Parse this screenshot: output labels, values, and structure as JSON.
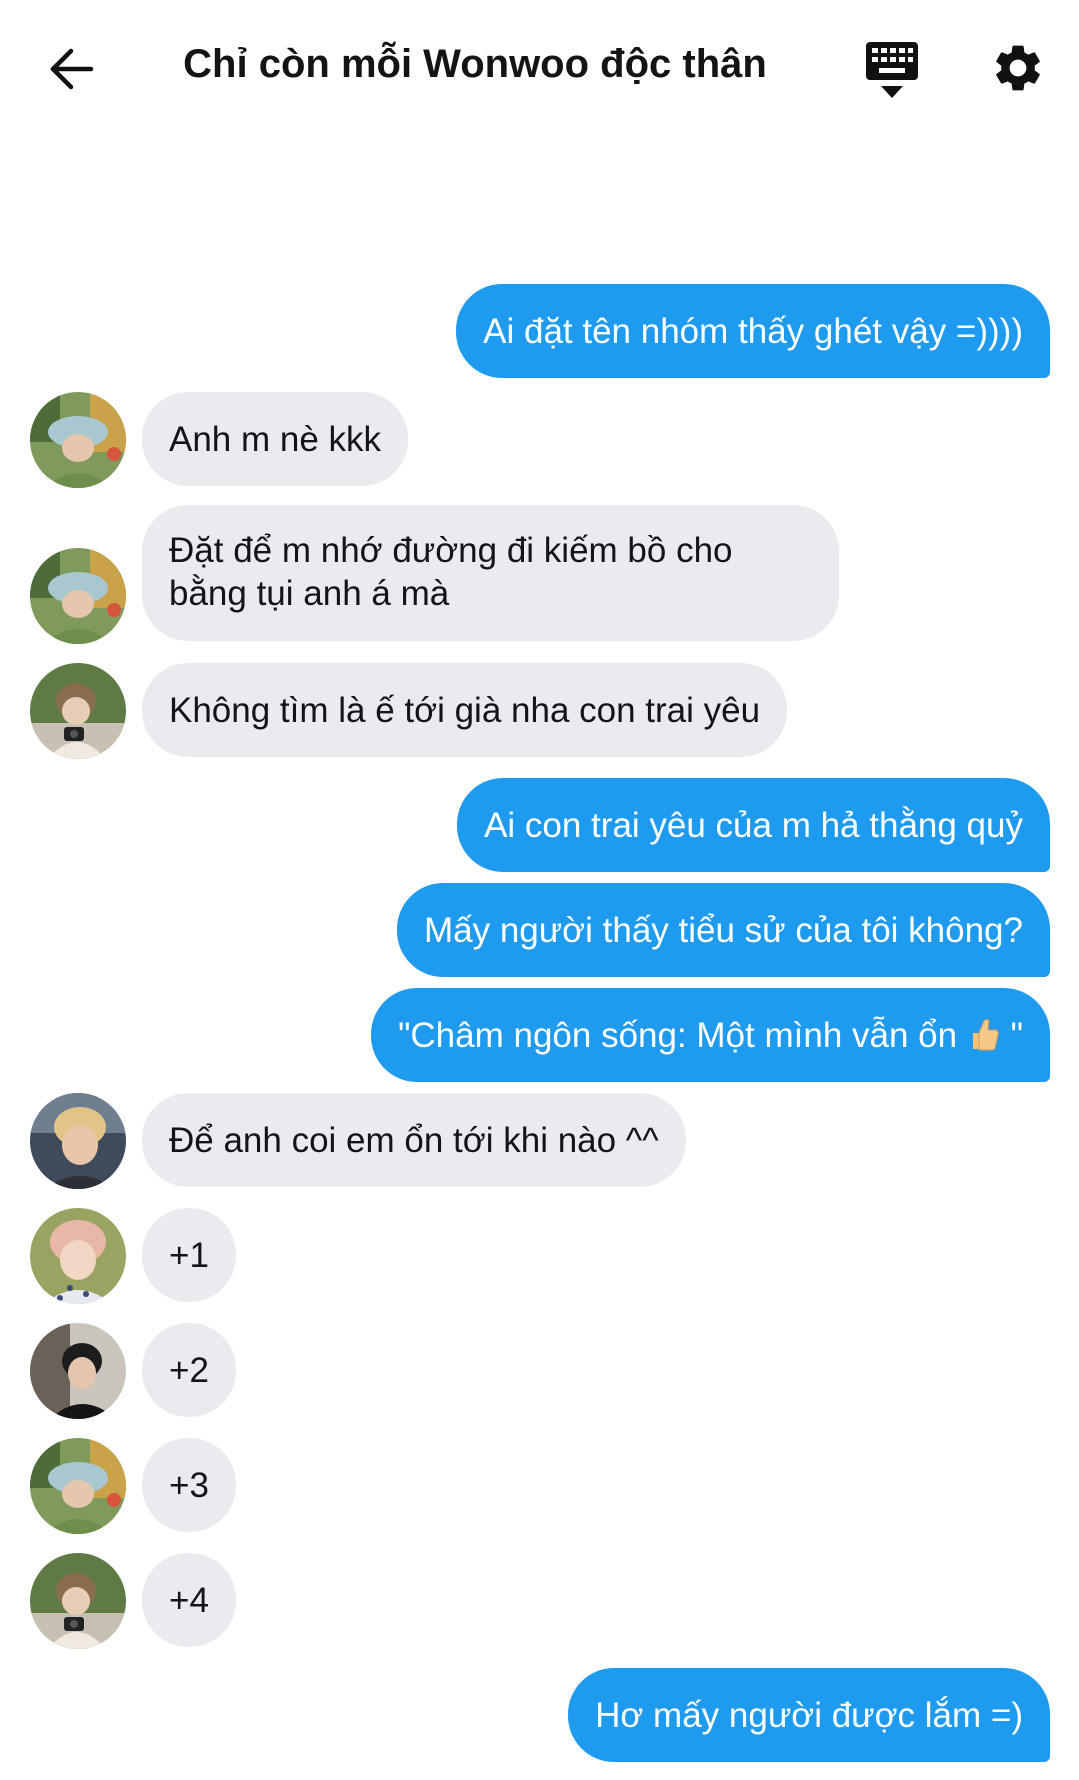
{
  "header": {
    "title": "Chỉ còn mỗi Wonwoo độc thân",
    "back_icon": "arrow-left-icon",
    "keyboard_icon": "keyboard-hide-icon",
    "settings_icon": "gear-icon"
  },
  "colors": {
    "outgoing_bubble": "#1e9bef",
    "incoming_bubble": "#e9ebef",
    "outgoing_text": "#ffffff",
    "incoming_text": "#121417"
  },
  "messages": [
    {
      "side": "out",
      "text": "Ai đặt tên nhóm thấy ghét vậy =))))"
    },
    {
      "side": "in",
      "avatar": "avatar-bucket-hat",
      "text": "Anh m nè kkk"
    },
    {
      "side": "in",
      "avatar": "avatar-bucket-hat",
      "text": "Đặt để m nhớ đường đi kiếm bồ cho bằng tụi anh á mà"
    },
    {
      "side": "in",
      "avatar": "avatar-camera",
      "text": "Không tìm là ế tới già nha con trai yêu"
    },
    {
      "side": "out",
      "text": "Ai con trai yêu của m hả thằng quỷ"
    },
    {
      "side": "out",
      "text": "Mấy người thấy tiểu sử của tôi không?"
    },
    {
      "side": "out",
      "text_before": "\"Châm ngôn sống: Một mình vẫn ổn ",
      "emoji": "thumbs-up-icon",
      "text_after": " \""
    },
    {
      "side": "in",
      "avatar": "avatar-blond",
      "text": "Để anh coi em ổn tới khi nào ^^"
    },
    {
      "side": "in",
      "avatar": "avatar-pink-hair",
      "text": "+1"
    },
    {
      "side": "in",
      "avatar": "avatar-black-hair",
      "text": "+2"
    },
    {
      "side": "in",
      "avatar": "avatar-bucket-hat",
      "text": "+3"
    },
    {
      "side": "in",
      "avatar": "avatar-camera",
      "text": "+4"
    },
    {
      "side": "out",
      "text": "Hơ mấy người được lắm =)"
    }
  ]
}
